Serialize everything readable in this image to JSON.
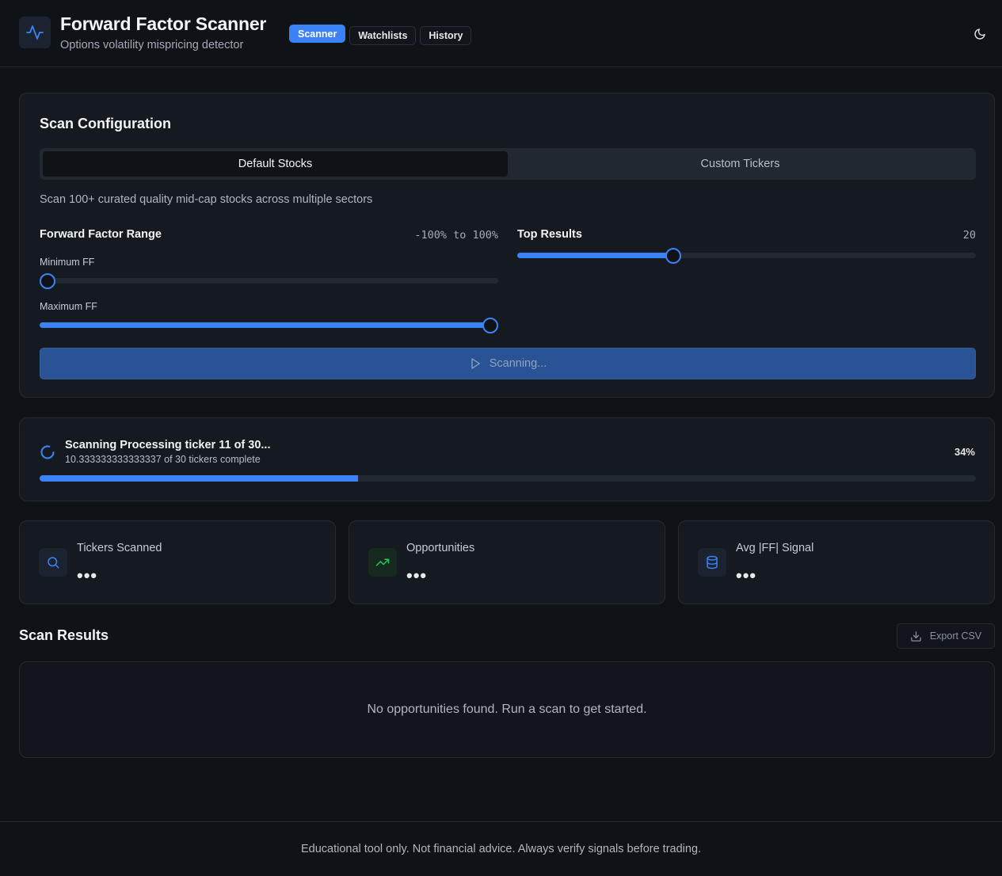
{
  "app": {
    "title": "Forward Factor Scanner",
    "subtitle": "Options volatility mispricing detector",
    "icon": "activity-icon"
  },
  "nav": {
    "tabs": [
      {
        "label": "Scanner",
        "active": true
      },
      {
        "label": "Watchlists",
        "active": false
      },
      {
        "label": "History",
        "active": false
      }
    ],
    "theme_icon": "moon-icon"
  },
  "config": {
    "title": "Scan Configuration",
    "tabs": [
      {
        "label": "Default Stocks",
        "active": true
      },
      {
        "label": "Custom Tickers",
        "active": false
      }
    ],
    "description": "Scan 100+ curated quality mid-cap stocks across multiple sectors",
    "ff_range": {
      "label": "Forward Factor Range",
      "value_text": "-100% to 100%",
      "min_label": "Minimum FF",
      "min_value": -100,
      "max_label": "Maximum FF",
      "max_value": 100
    },
    "top_results": {
      "label": "Top Results",
      "value": "20",
      "level": 0.34
    },
    "scan_button_label": "Scanning..."
  },
  "progress": {
    "title": "Scanning Processing ticker 11 of 30...",
    "subtitle": "10.333333333333337 of 30 tickers complete",
    "percent_text": "34%",
    "percent": 34
  },
  "stats": [
    {
      "label": "Tickers Scanned",
      "value": "•••",
      "icon": "search-icon",
      "accent": "#3b82f6"
    },
    {
      "label": "Opportunities",
      "value": "•••",
      "icon": "trending-up-icon",
      "accent": "#22c55e"
    },
    {
      "label": "Avg |FF| Signal",
      "value": "•••",
      "icon": "database-icon",
      "accent": "#3b82f6"
    }
  ],
  "results": {
    "title": "Scan Results",
    "export_label": "Export CSV",
    "empty_message": "No opportunities found. Run a scan to get started."
  },
  "footer": {
    "text": "Educational tool only. Not financial advice. Always verify signals before trading."
  },
  "colors": {
    "accent": "#3b82f6",
    "background": "#0f1217",
    "card": "#151920",
    "success": "#22c55e"
  }
}
